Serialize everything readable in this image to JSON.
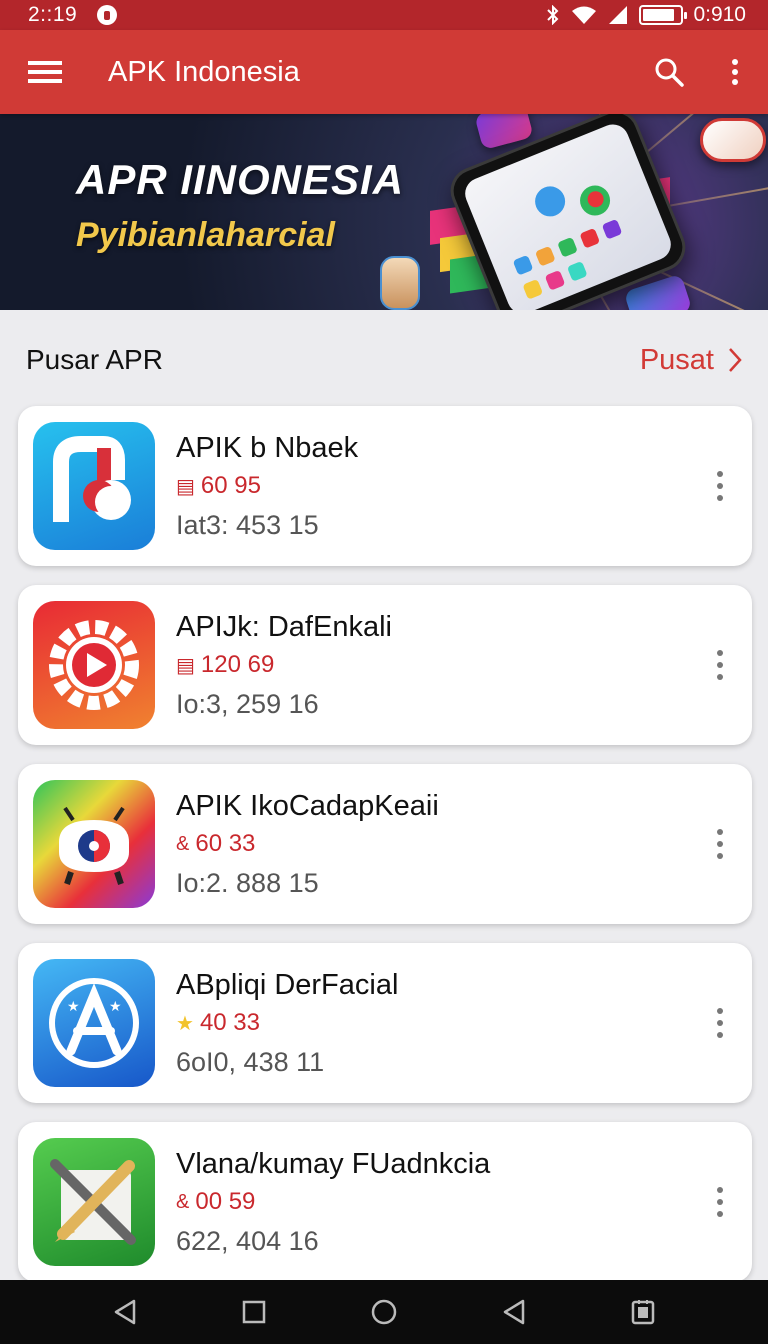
{
  "status": {
    "time": "2::19",
    "right": "0:910",
    "battery_level": 0.85
  },
  "appbar": {
    "title": "APK Indonesia",
    "menu_icon": "hamburger-icon",
    "search_icon": "search-icon",
    "more_icon": "overflow-icon"
  },
  "banner": {
    "title": "APR IINONESIA",
    "subtitle": "Pyibianlaharcial"
  },
  "section": {
    "title": "Pusar APR",
    "link": "Pusat"
  },
  "apps": [
    {
      "name": "APIK b Nbaek",
      "meta_icon": "calendar-icon",
      "meta": "60 95",
      "stat": "Iat3: 453 15",
      "icon": "music-note-icon",
      "colors": [
        "#1fb6e8",
        "#1a6fd8"
      ]
    },
    {
      "name": "APIJk: DafEnkali",
      "meta_icon": "calendar-icon",
      "meta": "120 69",
      "stat": "Io:3, 259 16",
      "icon": "play-gear-icon",
      "colors": [
        "#e8333a",
        "#f29a2e"
      ]
    },
    {
      "name": "APIK IkoCadapKeaii",
      "meta_icon": "link-icon",
      "meta": "60 33",
      "stat": "Io:2. 888 15",
      "icon": "android-icon",
      "colors": [
        "#2fc45a",
        "#e8303a",
        "#8a3ad8"
      ]
    },
    {
      "name": "ABpliqi DerFacial",
      "meta_icon": "star-icon",
      "meta": "40 33",
      "stat": "6oI0, 438 11",
      "icon": "app-store-icon",
      "colors": [
        "#3fb0f2",
        "#1a5fcf"
      ]
    },
    {
      "name": "Vlana/kumay FUadnkcia",
      "meta_icon": "link-icon",
      "meta": "00 59",
      "stat": "622, 404 16",
      "icon": "tools-icon",
      "colors": [
        "#48c24a",
        "#1e8a2a"
      ]
    }
  ],
  "navbar": {
    "back_icon": "back-icon",
    "recents_icon": "square-icon",
    "home_icon": "home-circle-icon",
    "back2_icon": "back-icon",
    "screenshot_icon": "screenshot-icon"
  }
}
